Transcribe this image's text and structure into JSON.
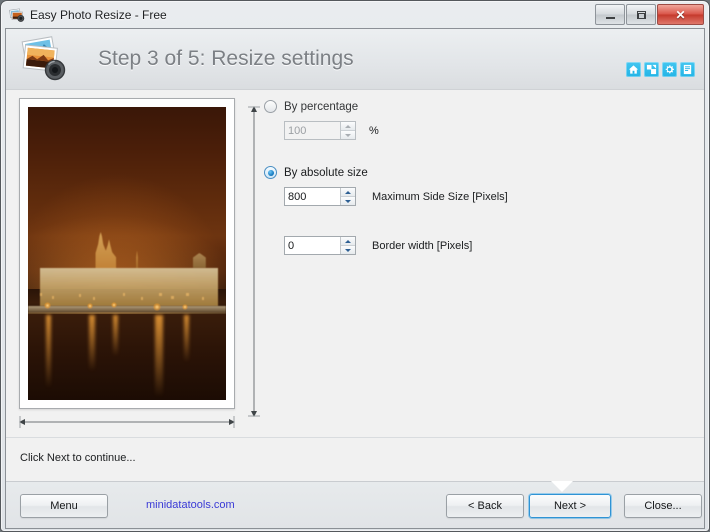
{
  "window": {
    "title": "Easy Photo Resize - Free",
    "app_icon": "photo-magnifier-icon",
    "controls": {
      "minimize": "minimize-icon",
      "maximize": "maximize-icon",
      "close": "close-icon"
    }
  },
  "header": {
    "logo_icon": "photo-magnifier-logo",
    "step_title": "Step 3 of 5: Resize settings",
    "toolbar": [
      {
        "name": "home-icon",
        "glyph": "⌂"
      },
      {
        "name": "resize-icon",
        "glyph": "⤡"
      },
      {
        "name": "gear-icon",
        "glyph": "⚙"
      },
      {
        "name": "help-document-icon",
        "glyph": "☰"
      }
    ]
  },
  "preview": {
    "name": "image-preview",
    "alt": "Night photo of Prague Castle above the river with golden light reflections",
    "width_arrow": "width-dimension-arrow",
    "height_arrow": "height-dimension-arrow"
  },
  "form": {
    "by_percentage": {
      "label": "By percentage",
      "selected": false,
      "value": "100",
      "unit": "%"
    },
    "by_absolute_size": {
      "label": "By absolute size",
      "selected": true,
      "value": "800",
      "unit": "Maximum Side Size [Pixels]"
    },
    "border_width": {
      "value": "0",
      "unit": "Border width [Pixels]"
    }
  },
  "status": {
    "text": "Click Next to continue..."
  },
  "footer": {
    "menu_label": "Menu",
    "website": "minidatatools.com",
    "back_label": "< Back",
    "next_label": "Next >",
    "close_label": "Close..."
  },
  "colors": {
    "accent": "#22b4e6",
    "link": "#3a3ad6",
    "focus": "#2f93d4",
    "close_button": "#c4392c"
  }
}
